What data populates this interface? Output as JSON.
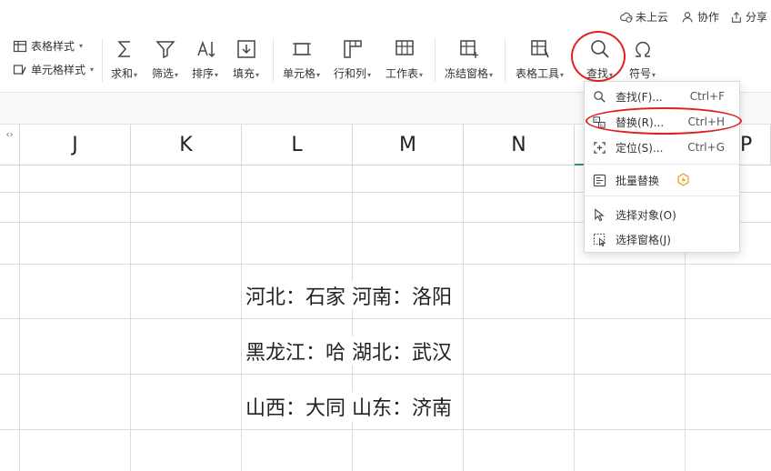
{
  "topbar": {
    "unsynced": "未上云",
    "collab": "协作",
    "share": "分享"
  },
  "ribbon": {
    "table_style": "表格样式",
    "cell_style": "单元格样式",
    "sum": "求和",
    "filter": "筛选",
    "sort": "排序",
    "fill": "填充",
    "cell": "单元格",
    "row_col": "行和列",
    "worksheet": "工作表",
    "freeze": "冻结窗格",
    "table_tools": "表格工具",
    "find": "查找",
    "symbol": "符号"
  },
  "columns": [
    "J",
    "K",
    "L",
    "M",
    "N",
    "P"
  ],
  "cells": [
    {
      "a": "河北：石家",
      "b": "河南：洛阳"
    },
    {
      "a": "黑龙江：哈",
      "b": "湖北：武汉"
    },
    {
      "a": "山西：大同",
      "b": "山东：济南"
    }
  ],
  "dropdown": {
    "items": [
      {
        "label": "查找(F)...",
        "shortcut": "Ctrl+F",
        "icon": "search-icon"
      },
      {
        "label": "替换(R)...",
        "shortcut": "Ctrl+H",
        "icon": "replace-icon"
      },
      {
        "label": "定位(S)...",
        "shortcut": "Ctrl+G",
        "icon": "locate-icon"
      },
      {
        "label": "批量替换",
        "shortcut": "",
        "icon": "batch-replace-icon"
      },
      {
        "label": "选择对象(O)",
        "shortcut": "",
        "icon": "cursor-icon"
      },
      {
        "label": "选择窗格(J)",
        "shortcut": "",
        "icon": "selection-pane-icon"
      }
    ]
  },
  "colors": {
    "annotation": "#e02020",
    "premium": "#f0a020"
  }
}
